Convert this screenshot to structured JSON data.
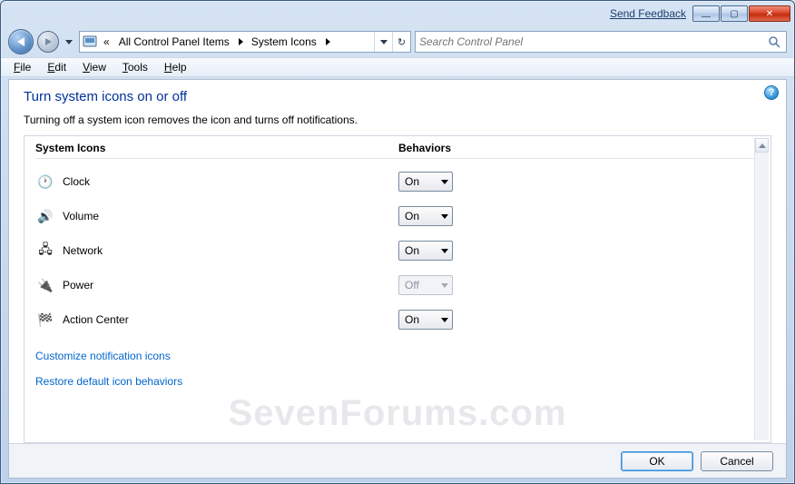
{
  "titlebar": {
    "feedback": "Send Feedback"
  },
  "breadcrumb": {
    "prefix": "«",
    "items": [
      "All Control Panel Items",
      "System Icons"
    ]
  },
  "search": {
    "placeholder": "Search Control Panel"
  },
  "menu": {
    "file": "File",
    "edit": "Edit",
    "view": "View",
    "tools": "Tools",
    "help": "Help"
  },
  "page": {
    "title": "Turn system icons on or off",
    "desc": "Turning off a system icon removes the icon and turns off notifications.",
    "col_icons": "System Icons",
    "col_behaviors": "Behaviors"
  },
  "rows": [
    {
      "label": "Clock",
      "value": "On",
      "disabled": false,
      "glyph": "🕐",
      "name": "clock"
    },
    {
      "label": "Volume",
      "value": "On",
      "disabled": false,
      "glyph": "🔊",
      "name": "volume"
    },
    {
      "label": "Network",
      "value": "On",
      "disabled": false,
      "glyph": "🖧",
      "name": "network"
    },
    {
      "label": "Power",
      "value": "Off",
      "disabled": true,
      "glyph": "🔌",
      "name": "power"
    },
    {
      "label": "Action Center",
      "value": "On",
      "disabled": false,
      "glyph": "🏁",
      "name": "action-center"
    }
  ],
  "links": {
    "customize": "Customize notification icons",
    "restore": "Restore default icon behaviors"
  },
  "buttons": {
    "ok": "OK",
    "cancel": "Cancel"
  },
  "watermark": "SevenForums.com"
}
